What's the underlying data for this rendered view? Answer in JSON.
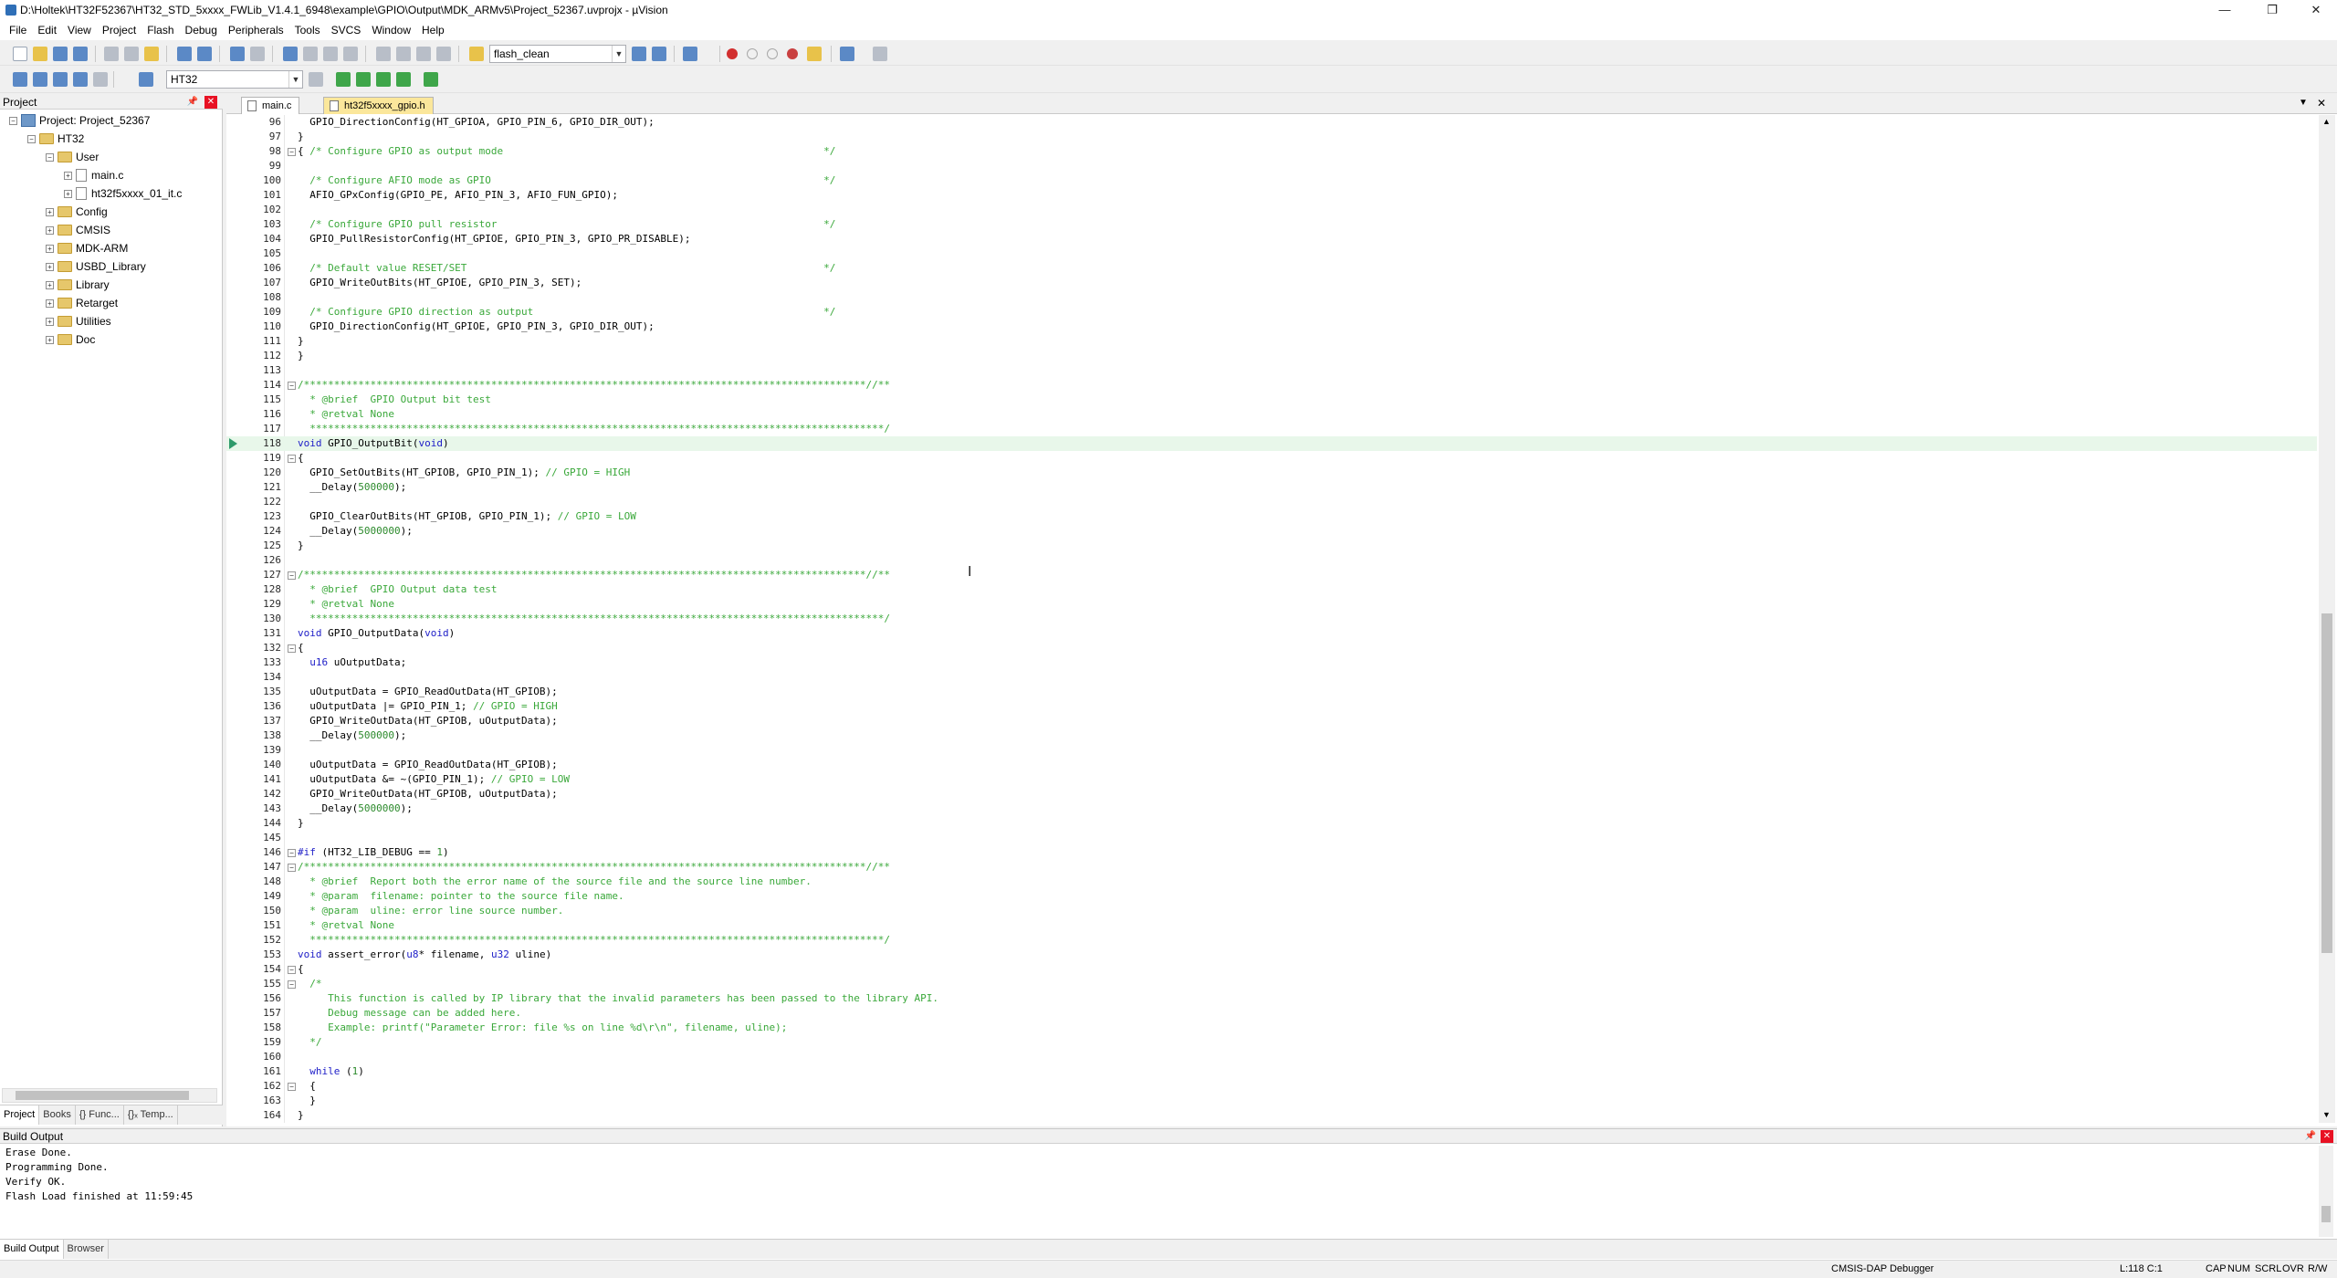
{
  "window": {
    "title": "D:\\Holtek\\HT32F52367\\HT32_STD_5xxxx_FWLib_V1.4.1_6948\\example\\GPIO\\Output\\MDK_ARMv5\\Project_52367.uvprojx - µVision"
  },
  "menu": [
    "File",
    "Edit",
    "View",
    "Project",
    "Flash",
    "Debug",
    "Peripherals",
    "Tools",
    "SVCS",
    "Window",
    "Help"
  ],
  "toolbar": {
    "target_combo": "flash_clean",
    "target_select": "HT32"
  },
  "project_panel": {
    "title": "Project",
    "tree": [
      {
        "label": "Project: Project_52367",
        "depth": 0,
        "type": "project",
        "exp": "−"
      },
      {
        "label": "HT32",
        "depth": 1,
        "type": "folder",
        "exp": "−"
      },
      {
        "label": "User",
        "depth": 2,
        "type": "folder",
        "exp": "−"
      },
      {
        "label": "main.c",
        "depth": 3,
        "type": "file",
        "exp": "+"
      },
      {
        "label": "ht32f5xxxx_01_it.c",
        "depth": 3,
        "type": "file",
        "exp": "+"
      },
      {
        "label": "Config",
        "depth": 2,
        "type": "folder",
        "exp": "+"
      },
      {
        "label": "CMSIS",
        "depth": 2,
        "type": "folder",
        "exp": "+"
      },
      {
        "label": "MDK-ARM",
        "depth": 2,
        "type": "folder",
        "exp": "+"
      },
      {
        "label": "USBD_Library",
        "depth": 2,
        "type": "folder",
        "exp": "+"
      },
      {
        "label": "Library",
        "depth": 2,
        "type": "folder",
        "exp": "+"
      },
      {
        "label": "Retarget",
        "depth": 2,
        "type": "folder",
        "exp": "+"
      },
      {
        "label": "Utilities",
        "depth": 2,
        "type": "folder",
        "exp": "+"
      },
      {
        "label": "Doc",
        "depth": 2,
        "type": "folder",
        "exp": "+"
      }
    ],
    "tabs": [
      "Project",
      "Books",
      "{} Func...",
      "{}ₓ Temp..."
    ]
  },
  "editor": {
    "tabs": [
      "main.c",
      "ht32f5xxxx_gpio.h"
    ],
    "lines": [
      {
        "n": "96",
        "t": "  GPIO_DirectionConfig(HT_GPIOA, GPIO_PIN_6, GPIO_DIR_OUT);"
      },
      {
        "n": "97",
        "t": "}"
      },
      {
        "n": "98",
        "t": "{ /* Configure GPIO as output mode                                                     */",
        "fold": "−"
      },
      {
        "n": "99",
        "t": ""
      },
      {
        "n": "100",
        "t": "  /* Configure AFIO mode as GPIO                                                       */"
      },
      {
        "n": "101",
        "t": "  AFIO_GPxConfig(GPIO_PE, AFIO_PIN_3, AFIO_FUN_GPIO);"
      },
      {
        "n": "102",
        "t": ""
      },
      {
        "n": "103",
        "t": "  /* Configure GPIO pull resistor                                                      */"
      },
      {
        "n": "104",
        "t": "  GPIO_PullResistorConfig(HT_GPIOE, GPIO_PIN_3, GPIO_PR_DISABLE);"
      },
      {
        "n": "105",
        "t": ""
      },
      {
        "n": "106",
        "t": "  /* Default value RESET/SET                                                           */"
      },
      {
        "n": "107",
        "t": "  GPIO_WriteOutBits(HT_GPIOE, GPIO_PIN_3, SET);"
      },
      {
        "n": "108",
        "t": ""
      },
      {
        "n": "109",
        "t": "  /* Configure GPIO direction as output                                                */"
      },
      {
        "n": "110",
        "t": "  GPIO_DirectionConfig(HT_GPIOE, GPIO_PIN_3, GPIO_DIR_OUT);"
      },
      {
        "n": "111",
        "t": "}"
      },
      {
        "n": "112",
        "t": "}"
      },
      {
        "n": "113",
        "t": ""
      },
      {
        "n": "114",
        "t": "/*********************************************************************************************//**",
        "fold": "−"
      },
      {
        "n": "115",
        "t": "  * @brief  GPIO Output bit test"
      },
      {
        "n": "116",
        "t": "  * @retval None"
      },
      {
        "n": "117",
        "t": "  ***********************************************************************************************/"
      },
      {
        "n": "118",
        "t": "void GPIO_OutputBit(void)",
        "cur": true
      },
      {
        "n": "119",
        "t": "{",
        "fold": "−"
      },
      {
        "n": "120",
        "t": "  GPIO_SetOutBits(HT_GPIOB, GPIO_PIN_1); // GPIO = HIGH"
      },
      {
        "n": "121",
        "t": "  __Delay(500000);"
      },
      {
        "n": "122",
        "t": ""
      },
      {
        "n": "123",
        "t": "  GPIO_ClearOutBits(HT_GPIOB, GPIO_PIN_1); // GPIO = LOW"
      },
      {
        "n": "124",
        "t": "  __Delay(5000000);"
      },
      {
        "n": "125",
        "t": "}"
      },
      {
        "n": "126",
        "t": ""
      },
      {
        "n": "127",
        "t": "/*********************************************************************************************//**",
        "fold": "−"
      },
      {
        "n": "128",
        "t": "  * @brief  GPIO Output data test"
      },
      {
        "n": "129",
        "t": "  * @retval None"
      },
      {
        "n": "130",
        "t": "  ***********************************************************************************************/"
      },
      {
        "n": "131",
        "t": "void GPIO_OutputData(void)"
      },
      {
        "n": "132",
        "t": "{",
        "fold": "−"
      },
      {
        "n": "133",
        "t": "  u16 uOutputData;"
      },
      {
        "n": "134",
        "t": ""
      },
      {
        "n": "135",
        "t": "  uOutputData = GPIO_ReadOutData(HT_GPIOB);"
      },
      {
        "n": "136",
        "t": "  uOutputData |= GPIO_PIN_1; // GPIO = HIGH"
      },
      {
        "n": "137",
        "t": "  GPIO_WriteOutData(HT_GPIOB, uOutputData);"
      },
      {
        "n": "138",
        "t": "  __Delay(500000);"
      },
      {
        "n": "139",
        "t": ""
      },
      {
        "n": "140",
        "t": "  uOutputData = GPIO_ReadOutData(HT_GPIOB);"
      },
      {
        "n": "141",
        "t": "  uOutputData &= ~(GPIO_PIN_1); // GPIO = LOW"
      },
      {
        "n": "142",
        "t": "  GPIO_WriteOutData(HT_GPIOB, uOutputData);"
      },
      {
        "n": "143",
        "t": "  __Delay(5000000);"
      },
      {
        "n": "144",
        "t": "}"
      },
      {
        "n": "145",
        "t": ""
      },
      {
        "n": "146",
        "t": "#if (HT32_LIB_DEBUG == 1)",
        "fold": "−"
      },
      {
        "n": "147",
        "t": "/*********************************************************************************************//**",
        "fold": "−"
      },
      {
        "n": "148",
        "t": "  * @brief  Report both the error name of the source file and the source line number."
      },
      {
        "n": "149",
        "t": "  * @param  filename: pointer to the source file name."
      },
      {
        "n": "150",
        "t": "  * @param  uline: error line source number."
      },
      {
        "n": "151",
        "t": "  * @retval None"
      },
      {
        "n": "152",
        "t": "  ***********************************************************************************************/"
      },
      {
        "n": "153",
        "t": "void assert_error(u8* filename, u32 uline)"
      },
      {
        "n": "154",
        "t": "{",
        "fold": "−"
      },
      {
        "n": "155",
        "t": "  /*",
        "fold": "−"
      },
      {
        "n": "156",
        "t": "     This function is called by IP library that the invalid parameters has been passed to the library API."
      },
      {
        "n": "157",
        "t": "     Debug message can be added here."
      },
      {
        "n": "158",
        "t": "     Example: printf(\"Parameter Error: file %s on line %d\\r\\n\", filename, uline);"
      },
      {
        "n": "159",
        "t": "  */"
      },
      {
        "n": "160",
        "t": ""
      },
      {
        "n": "161",
        "t": "  while (1)"
      },
      {
        "n": "162",
        "t": "  {",
        "fold": "−"
      },
      {
        "n": "163",
        "t": "  }"
      },
      {
        "n": "164",
        "t": "}"
      }
    ]
  },
  "build_output": {
    "title": "Build Output",
    "lines": [
      "Erase Done.",
      "Programming Done.",
      "Verify OK.",
      "Flash Load finished at 11:59:45"
    ],
    "tabs": [
      "Build Output",
      "Browser"
    ]
  },
  "statusbar": {
    "debugger": "CMSIS-DAP Debugger",
    "position": "L:118 C:1",
    "indicators": [
      "CAP",
      "NUM",
      "SCRL",
      "OVR",
      "R/W"
    ]
  },
  "window_buttons": {
    "minimize": "—",
    "restore": "❐",
    "close": "✕"
  }
}
